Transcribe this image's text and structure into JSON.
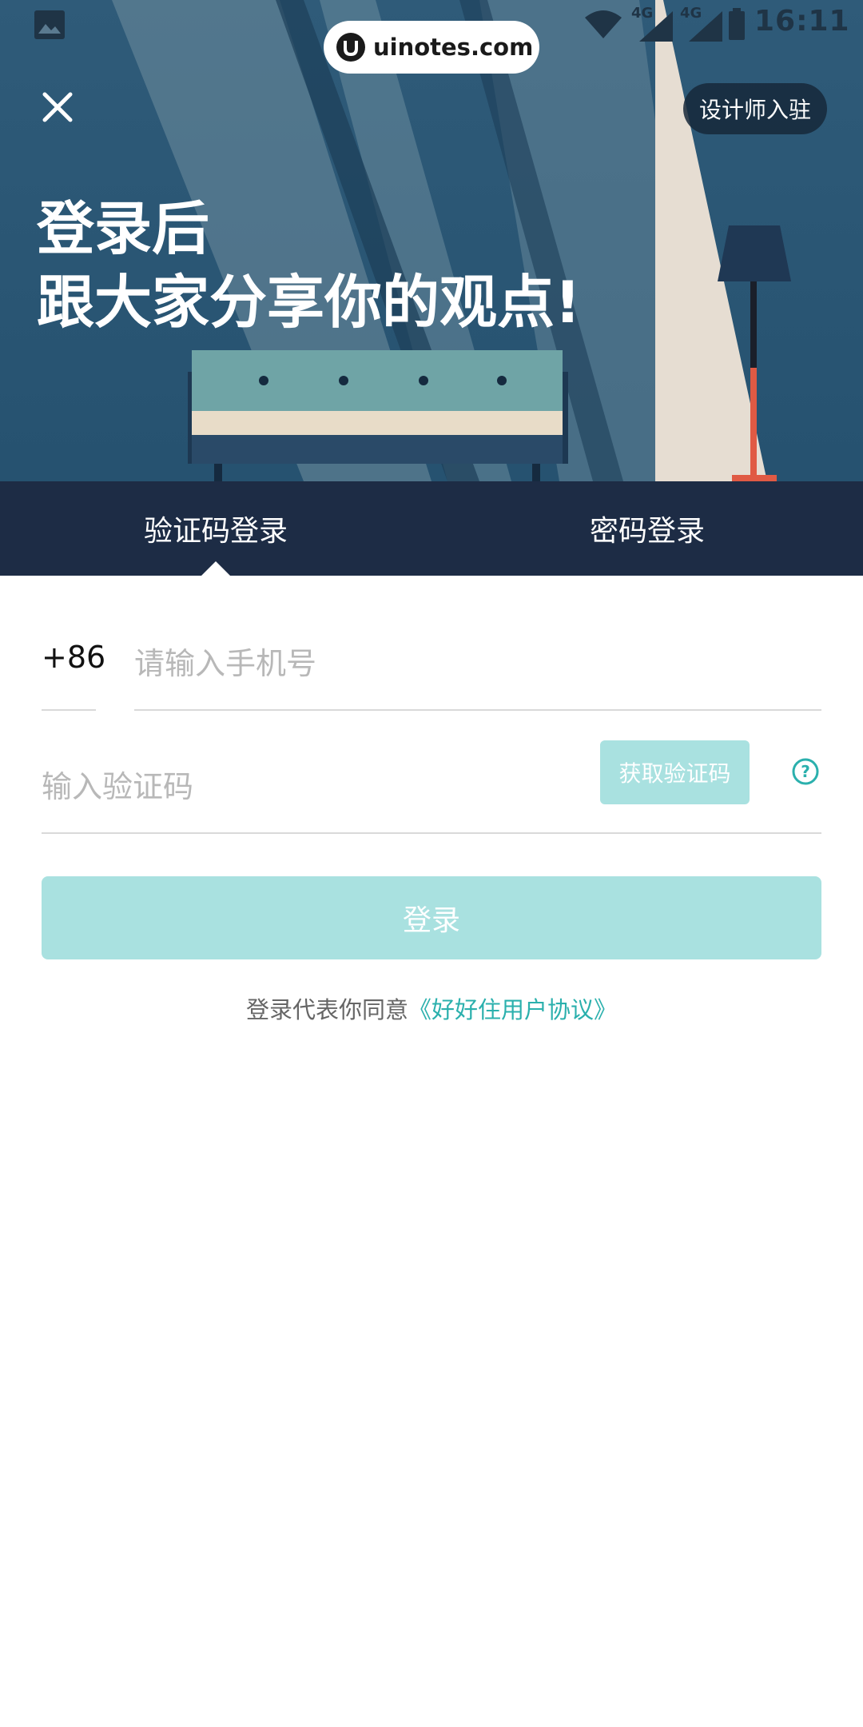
{
  "status_bar": {
    "time": "16:11",
    "signal_1_label": "4G",
    "signal_2_label": "4G"
  },
  "watermark": {
    "text": "uinotes.com"
  },
  "header": {
    "designer_label": "设计师入驻",
    "title_line1": "登录后",
    "title_line2": "跟大家分享你的观点!"
  },
  "tabs": [
    {
      "label": "验证码登录",
      "active": true
    },
    {
      "label": "密码登录",
      "active": false
    }
  ],
  "form": {
    "country_code": "+86",
    "phone_placeholder": "请输入手机号",
    "code_placeholder": "输入验证码",
    "get_code_label": "获取验证码",
    "login_label": "登录",
    "agreement_prefix": "登录代表你同意",
    "agreement_link": "《好好住用户协议》"
  },
  "colors": {
    "accent": "#2bb0ad",
    "button_disabled": "#a9e1e0",
    "tab_bar": "#1d2c45",
    "hero": "#2c5a79"
  }
}
